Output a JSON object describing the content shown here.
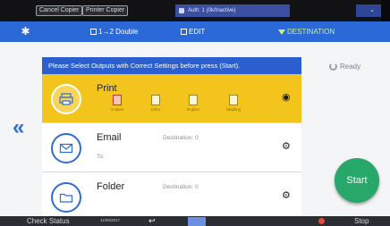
{
  "topbar": {
    "btn1": "Cancel Copier",
    "btn2": "Printer Copier",
    "status": "Auth: 1 (0k/Inactive)",
    "right_badge": "⌄"
  },
  "tabs": {
    "gear_icon": "gear-icon",
    "duplex": "1→2 Double",
    "edit": "EDIT",
    "destination": "DESTINATION"
  },
  "main": {
    "banner": "Please Select Outputs with Correct Settings before press (Start).",
    "ready": "Ready",
    "back": "«",
    "rows": [
      {
        "title": "Print",
        "selected": true,
        "options": [
          "Copies",
          "Color",
          "Duplex",
          "Stapling"
        ]
      },
      {
        "title": "Email",
        "selected": false,
        "destination_label": "Destination: 0",
        "sub_value": "To:"
      },
      {
        "title": "Folder",
        "selected": false,
        "destination_label": "Destination: 0",
        "sub_value": ""
      }
    ],
    "start": "Start"
  },
  "bottombar": {
    "check_status": "Check Status",
    "date": "11/05/2017",
    "stop": "Stop"
  },
  "colors": {
    "accent_blue": "#2b69d8",
    "selected_yellow": "#f3c51c",
    "start_green": "#27a86a"
  }
}
